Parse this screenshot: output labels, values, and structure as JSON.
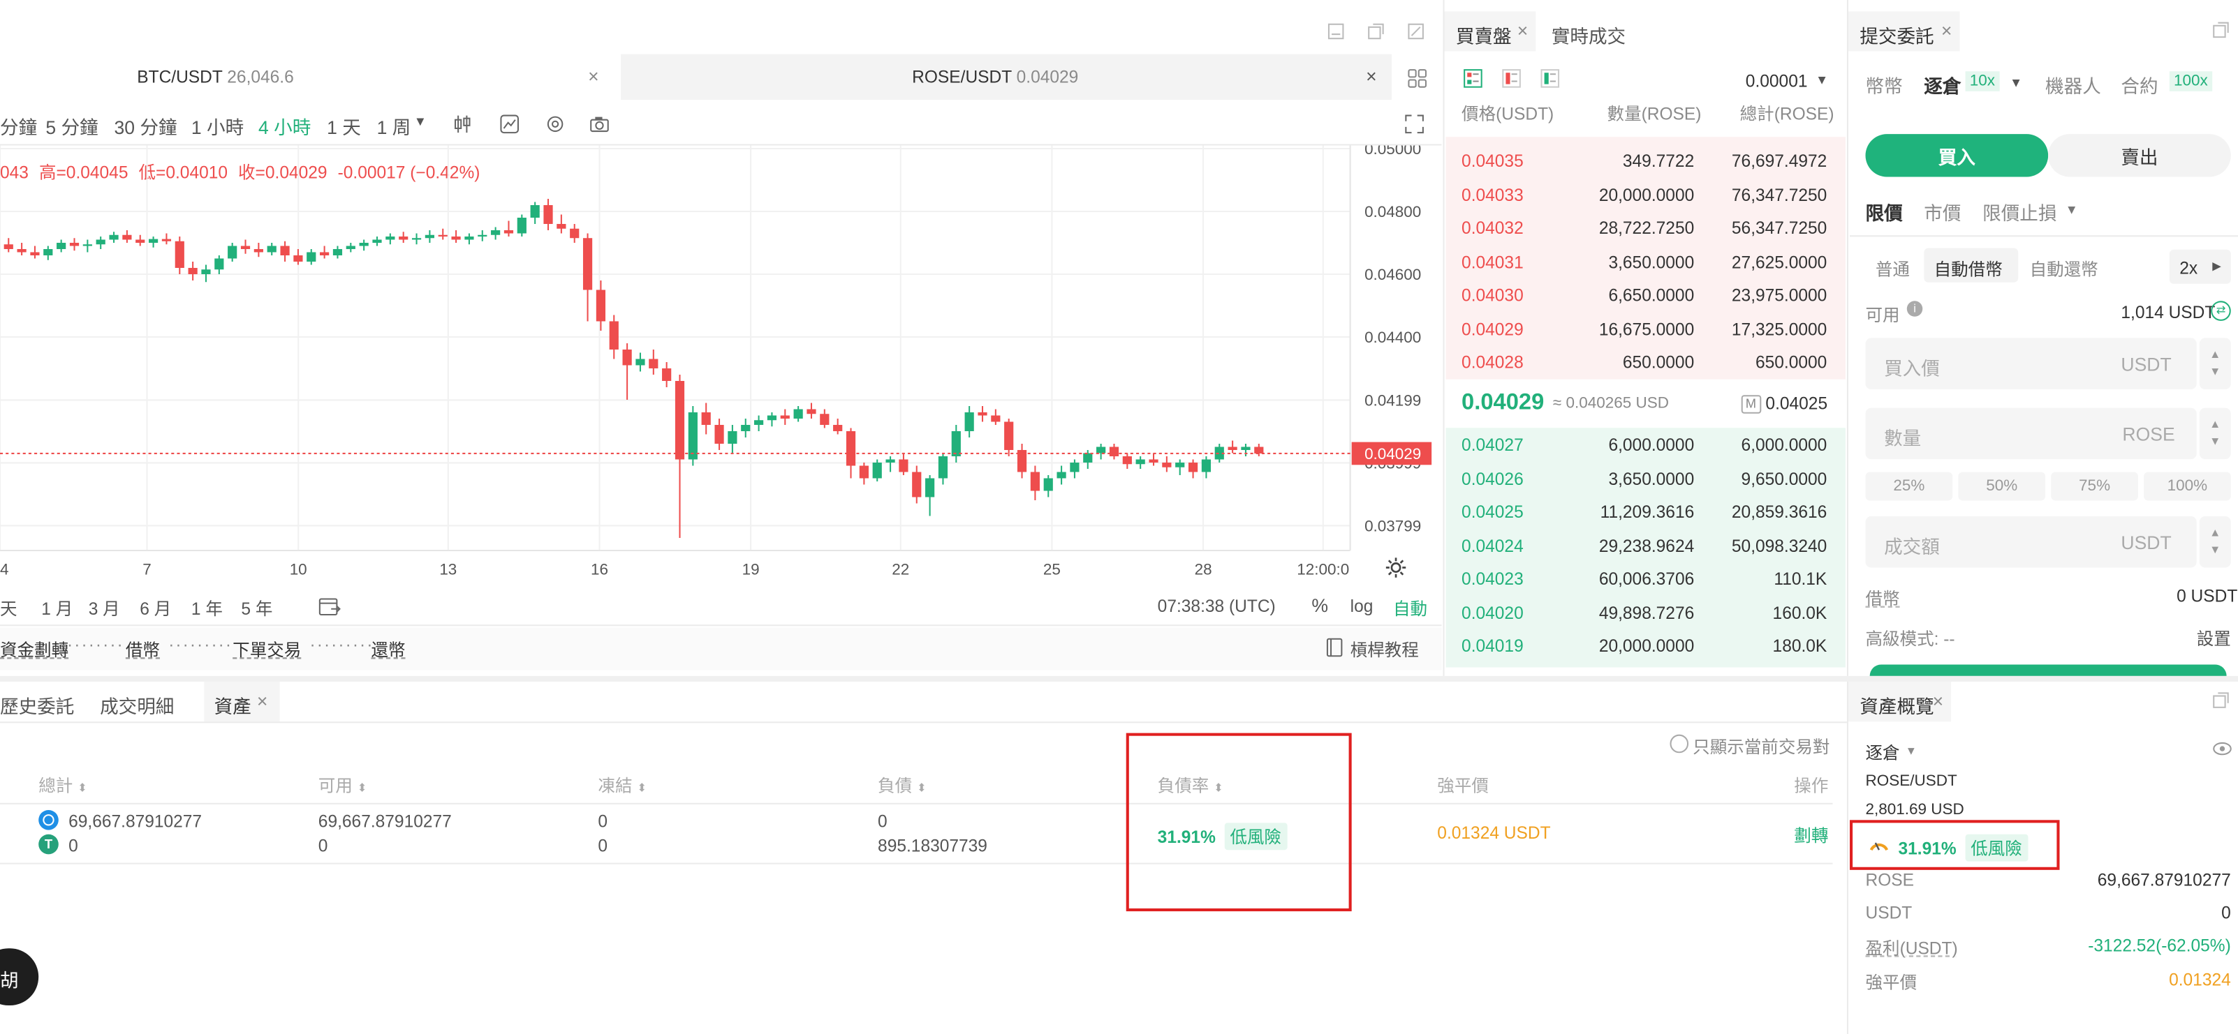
{
  "chart_toolbar": {
    "tabs": [
      {
        "pair": "BTC/USDT",
        "price": "26,046.6"
      },
      {
        "pair": "ROSE/USDT",
        "price": "0.04029"
      }
    ],
    "intervals": [
      "分鐘",
      "5 分鐘",
      "30 分鐘",
      "1 小時",
      "4 小時",
      "1 天",
      "1 周"
    ],
    "active_interval": "4 小時",
    "ohlc": {
      "open_fragment": "043",
      "high": "高=0.04045",
      "low": "低=0.04010",
      "close": "收=0.04029",
      "change": "-0.00017 (−0.42%)"
    },
    "ranges": [
      "天",
      "1 月",
      "3 月",
      "6 月",
      "1 年",
      "5 年"
    ],
    "clock": "07:38:38 (UTC)",
    "scale_pct": "%",
    "scale_log": "log",
    "scale_auto": "自動",
    "flow": [
      "資金劃轉",
      "借幣",
      "下單交易",
      "還幣"
    ],
    "tutorial": "槓桿教程"
  },
  "chart_data": {
    "type": "candlestick",
    "x_ticks": [
      "4",
      "7",
      "10",
      "13",
      "16",
      "19",
      "22",
      "25",
      "28",
      "12:00:0"
    ],
    "y_ticks": [
      "0.05000",
      "0.04800",
      "0.04600",
      "0.04400",
      "0.04199",
      "0.03999",
      "0.03799"
    ],
    "ylim": [
      0.0372,
      0.0501
    ],
    "last_price": "0.04029",
    "last_value": 0.04029,
    "candles": [
      {
        "o": 0.04695,
        "h": 0.04715,
        "l": 0.0467,
        "c": 0.0468
      },
      {
        "o": 0.0468,
        "h": 0.047,
        "l": 0.0466,
        "c": 0.0467
      },
      {
        "o": 0.0467,
        "h": 0.0469,
        "l": 0.0465,
        "c": 0.0466
      },
      {
        "o": 0.0466,
        "h": 0.0469,
        "l": 0.04645,
        "c": 0.0468
      },
      {
        "o": 0.0468,
        "h": 0.0471,
        "l": 0.0467,
        "c": 0.047
      },
      {
        "o": 0.047,
        "h": 0.04715,
        "l": 0.04675,
        "c": 0.0469
      },
      {
        "o": 0.0469,
        "h": 0.0471,
        "l": 0.0467,
        "c": 0.04695
      },
      {
        "o": 0.04695,
        "h": 0.0472,
        "l": 0.0468,
        "c": 0.0471
      },
      {
        "o": 0.0471,
        "h": 0.04735,
        "l": 0.047,
        "c": 0.04725
      },
      {
        "o": 0.04725,
        "h": 0.0474,
        "l": 0.047,
        "c": 0.0471
      },
      {
        "o": 0.0471,
        "h": 0.04725,
        "l": 0.0469,
        "c": 0.047
      },
      {
        "o": 0.047,
        "h": 0.0472,
        "l": 0.04685,
        "c": 0.04712
      },
      {
        "o": 0.04712,
        "h": 0.0473,
        "l": 0.04695,
        "c": 0.04705
      },
      {
        "o": 0.04705,
        "h": 0.0472,
        "l": 0.046,
        "c": 0.0462
      },
      {
        "o": 0.0462,
        "h": 0.0464,
        "l": 0.0458,
        "c": 0.046
      },
      {
        "o": 0.046,
        "h": 0.0463,
        "l": 0.04575,
        "c": 0.04615
      },
      {
        "o": 0.04615,
        "h": 0.0466,
        "l": 0.046,
        "c": 0.0465
      },
      {
        "o": 0.0465,
        "h": 0.047,
        "l": 0.0464,
        "c": 0.0469
      },
      {
        "o": 0.0469,
        "h": 0.0471,
        "l": 0.04665,
        "c": 0.0468
      },
      {
        "o": 0.0468,
        "h": 0.047,
        "l": 0.04655,
        "c": 0.0467
      },
      {
        "o": 0.0467,
        "h": 0.047,
        "l": 0.0466,
        "c": 0.0469
      },
      {
        "o": 0.0469,
        "h": 0.04705,
        "l": 0.0464,
        "c": 0.0466
      },
      {
        "o": 0.0466,
        "h": 0.0468,
        "l": 0.0463,
        "c": 0.0464
      },
      {
        "o": 0.0464,
        "h": 0.0468,
        "l": 0.0463,
        "c": 0.0467
      },
      {
        "o": 0.0467,
        "h": 0.0469,
        "l": 0.0465,
        "c": 0.0466
      },
      {
        "o": 0.0466,
        "h": 0.0469,
        "l": 0.0465,
        "c": 0.0468
      },
      {
        "o": 0.0468,
        "h": 0.047,
        "l": 0.0467,
        "c": 0.0469
      },
      {
        "o": 0.0469,
        "h": 0.0471,
        "l": 0.04675,
        "c": 0.047
      },
      {
        "o": 0.047,
        "h": 0.0472,
        "l": 0.0469,
        "c": 0.0471
      },
      {
        "o": 0.0471,
        "h": 0.0473,
        "l": 0.04695,
        "c": 0.0472
      },
      {
        "o": 0.0472,
        "h": 0.04735,
        "l": 0.047,
        "c": 0.0471
      },
      {
        "o": 0.0471,
        "h": 0.0473,
        "l": 0.04695,
        "c": 0.04715
      },
      {
        "o": 0.04715,
        "h": 0.0474,
        "l": 0.047,
        "c": 0.04725
      },
      {
        "o": 0.04725,
        "h": 0.04745,
        "l": 0.0471,
        "c": 0.0472
      },
      {
        "o": 0.0472,
        "h": 0.0474,
        "l": 0.047,
        "c": 0.0471
      },
      {
        "o": 0.0471,
        "h": 0.0473,
        "l": 0.04695,
        "c": 0.0472
      },
      {
        "o": 0.0472,
        "h": 0.0474,
        "l": 0.04705,
        "c": 0.04725
      },
      {
        "o": 0.04725,
        "h": 0.0475,
        "l": 0.0471,
        "c": 0.0474
      },
      {
        "o": 0.0474,
        "h": 0.0477,
        "l": 0.0472,
        "c": 0.0473
      },
      {
        "o": 0.0473,
        "h": 0.0479,
        "l": 0.0472,
        "c": 0.0478
      },
      {
        "o": 0.0478,
        "h": 0.0483,
        "l": 0.0476,
        "c": 0.0482
      },
      {
        "o": 0.0482,
        "h": 0.0484,
        "l": 0.0474,
        "c": 0.0476
      },
      {
        "o": 0.0476,
        "h": 0.0479,
        "l": 0.0473,
        "c": 0.04745
      },
      {
        "o": 0.04745,
        "h": 0.0476,
        "l": 0.047,
        "c": 0.04715
      },
      {
        "o": 0.04715,
        "h": 0.0473,
        "l": 0.0445,
        "c": 0.0455
      },
      {
        "o": 0.0455,
        "h": 0.0458,
        "l": 0.0442,
        "c": 0.0445
      },
      {
        "o": 0.0445,
        "h": 0.0447,
        "l": 0.0433,
        "c": 0.0436
      },
      {
        "o": 0.0436,
        "h": 0.0438,
        "l": 0.042,
        "c": 0.0431
      },
      {
        "o": 0.0431,
        "h": 0.0435,
        "l": 0.0429,
        "c": 0.0433
      },
      {
        "o": 0.0433,
        "h": 0.0436,
        "l": 0.0428,
        "c": 0.043
      },
      {
        "o": 0.043,
        "h": 0.0432,
        "l": 0.0424,
        "c": 0.0426
      },
      {
        "o": 0.0426,
        "h": 0.0428,
        "l": 0.0376,
        "c": 0.0401
      },
      {
        "o": 0.0401,
        "h": 0.0418,
        "l": 0.0399,
        "c": 0.0416
      },
      {
        "o": 0.0416,
        "h": 0.0419,
        "l": 0.0409,
        "c": 0.0412
      },
      {
        "o": 0.0412,
        "h": 0.0414,
        "l": 0.0404,
        "c": 0.0406
      },
      {
        "o": 0.0406,
        "h": 0.0412,
        "l": 0.0403,
        "c": 0.041
      },
      {
        "o": 0.041,
        "h": 0.0414,
        "l": 0.0408,
        "c": 0.0412
      },
      {
        "o": 0.0412,
        "h": 0.0415,
        "l": 0.041,
        "c": 0.04135
      },
      {
        "o": 0.04135,
        "h": 0.0416,
        "l": 0.04115,
        "c": 0.0415
      },
      {
        "o": 0.0415,
        "h": 0.0417,
        "l": 0.0412,
        "c": 0.0414
      },
      {
        "o": 0.0414,
        "h": 0.0418,
        "l": 0.0413,
        "c": 0.0417
      },
      {
        "o": 0.0417,
        "h": 0.0419,
        "l": 0.0414,
        "c": 0.04155
      },
      {
        "o": 0.04155,
        "h": 0.0417,
        "l": 0.0411,
        "c": 0.0412
      },
      {
        "o": 0.0412,
        "h": 0.0414,
        "l": 0.0409,
        "c": 0.041
      },
      {
        "o": 0.041,
        "h": 0.0411,
        "l": 0.0395,
        "c": 0.0399
      },
      {
        "o": 0.0399,
        "h": 0.04,
        "l": 0.0393,
        "c": 0.0395
      },
      {
        "o": 0.0395,
        "h": 0.0401,
        "l": 0.0394,
        "c": 0.04
      },
      {
        "o": 0.04,
        "h": 0.0402,
        "l": 0.0397,
        "c": 0.0401
      },
      {
        "o": 0.0401,
        "h": 0.0403,
        "l": 0.0396,
        "c": 0.0397
      },
      {
        "o": 0.0397,
        "h": 0.0399,
        "l": 0.0387,
        "c": 0.0389
      },
      {
        "o": 0.0389,
        "h": 0.0396,
        "l": 0.0383,
        "c": 0.0395
      },
      {
        "o": 0.0395,
        "h": 0.0403,
        "l": 0.0393,
        "c": 0.0402
      },
      {
        "o": 0.0402,
        "h": 0.0412,
        "l": 0.04,
        "c": 0.041
      },
      {
        "o": 0.041,
        "h": 0.0418,
        "l": 0.0408,
        "c": 0.0416
      },
      {
        "o": 0.0416,
        "h": 0.0418,
        "l": 0.0413,
        "c": 0.0415
      },
      {
        "o": 0.0415,
        "h": 0.0417,
        "l": 0.0412,
        "c": 0.0413
      },
      {
        "o": 0.0413,
        "h": 0.0414,
        "l": 0.0402,
        "c": 0.0404
      },
      {
        "o": 0.0404,
        "h": 0.0406,
        "l": 0.0395,
        "c": 0.0397
      },
      {
        "o": 0.0397,
        "h": 0.0399,
        "l": 0.0388,
        "c": 0.0391
      },
      {
        "o": 0.0391,
        "h": 0.0396,
        "l": 0.0389,
        "c": 0.0395
      },
      {
        "o": 0.0395,
        "h": 0.0399,
        "l": 0.0393,
        "c": 0.0397
      },
      {
        "o": 0.0397,
        "h": 0.0401,
        "l": 0.0395,
        "c": 0.04
      },
      {
        "o": 0.04,
        "h": 0.0404,
        "l": 0.0398,
        "c": 0.0403
      },
      {
        "o": 0.0403,
        "h": 0.0406,
        "l": 0.0401,
        "c": 0.0405
      },
      {
        "o": 0.0405,
        "h": 0.0406,
        "l": 0.0401,
        "c": 0.0402
      },
      {
        "o": 0.0402,
        "h": 0.0403,
        "l": 0.0398,
        "c": 0.03995
      },
      {
        "o": 0.03995,
        "h": 0.0402,
        "l": 0.0398,
        "c": 0.0401
      },
      {
        "o": 0.0401,
        "h": 0.0403,
        "l": 0.0399,
        "c": 0.04
      },
      {
        "o": 0.04,
        "h": 0.0402,
        "l": 0.0397,
        "c": 0.03985
      },
      {
        "o": 0.03985,
        "h": 0.0401,
        "l": 0.0396,
        "c": 0.04
      },
      {
        "o": 0.04,
        "h": 0.0401,
        "l": 0.0395,
        "c": 0.0397
      },
      {
        "o": 0.0397,
        "h": 0.0402,
        "l": 0.0395,
        "c": 0.0401
      },
      {
        "o": 0.0401,
        "h": 0.0406,
        "l": 0.04,
        "c": 0.0405
      },
      {
        "o": 0.0405,
        "h": 0.0407,
        "l": 0.0403,
        "c": 0.0404
      },
      {
        "o": 0.0404,
        "h": 0.0406,
        "l": 0.0402,
        "c": 0.0405
      },
      {
        "o": 0.0405,
        "h": 0.0406,
        "l": 0.0402,
        "c": 0.04029
      }
    ]
  },
  "orderbook": {
    "tabs": [
      "買賣盤",
      "實時成交"
    ],
    "precision": "0.00001",
    "headers": [
      "價格(USDT)",
      "數量(ROSE)",
      "總計(ROSE)"
    ],
    "asks": [
      [
        "0.04035",
        "349.7722",
        "76,697.4972"
      ],
      [
        "0.04033",
        "20,000.0000",
        "76,347.7250"
      ],
      [
        "0.04032",
        "28,722.7250",
        "56,347.7250"
      ],
      [
        "0.04031",
        "3,650.0000",
        "27,625.0000"
      ],
      [
        "0.04030",
        "6,650.0000",
        "23,975.0000"
      ],
      [
        "0.04029",
        "16,675.0000",
        "17,325.0000"
      ],
      [
        "0.04028",
        "650.0000",
        "650.0000"
      ]
    ],
    "mid": {
      "price": "0.04029",
      "approx": "≈ 0.040265 USD",
      "mark_icon": "M",
      "mark": "0.04025"
    },
    "bids": [
      [
        "0.04027",
        "6,000.0000",
        "6,000.0000"
      ],
      [
        "0.04026",
        "3,650.0000",
        "9,650.0000"
      ],
      [
        "0.04025",
        "11,209.3616",
        "20,859.3616"
      ],
      [
        "0.04024",
        "29,238.9624",
        "50,098.3240"
      ],
      [
        "0.04023",
        "60,006.3706",
        "110.1K"
      ],
      [
        "0.04020",
        "49,898.7276",
        "160.0K"
      ],
      [
        "0.04019",
        "20,000.0000",
        "180.0K"
      ]
    ]
  },
  "order_form": {
    "title": "提交委託",
    "modes": [
      "幣幣",
      "逐倉",
      "機器人",
      "合約"
    ],
    "isolated_leverage": "10x",
    "contract_leverage": "100x",
    "buy": "買入",
    "sell": "賣出",
    "types": [
      "限價",
      "市價",
      "限價止損"
    ],
    "borrow_modes": [
      "普通",
      "自動借幣",
      "自動還幣"
    ],
    "leverage_btn": "2x",
    "available_label": "可用",
    "available_value": "1,014 USDT",
    "price_placeholder": "買入價",
    "price_unit": "USDT",
    "qty_placeholder": "數量",
    "qty_unit": "ROSE",
    "pcts": [
      "25%",
      "50%",
      "75%",
      "100%"
    ],
    "amount_placeholder": "成交額",
    "amount_unit": "USDT",
    "borrow_label": "借幣",
    "borrow_value": "0 USDT",
    "advanced_label": "高級模式: --",
    "settings": "設置"
  },
  "bottom": {
    "tabs": [
      "歷史委託",
      "成交明細",
      "資產"
    ],
    "only_current": "只顯示當前交易對",
    "headers": [
      "總計",
      "可用",
      "凍結",
      "負債",
      "負債率",
      "強平價",
      "操作"
    ],
    "row": {
      "total_rose": "69,667.87910277",
      "total_usdt": "0",
      "avail_rose": "69,667.87910277",
      "avail_usdt": "0",
      "frozen_rose": "0",
      "frozen_usdt": "0",
      "debt_rose": "0",
      "debt_usdt": "895.18307739",
      "ratio": "31.91%",
      "risk": "低風險",
      "liq": "0.01324 USDT",
      "action": "劃轉"
    },
    "chat_btn": "胡"
  },
  "overview": {
    "title": "資產概覽",
    "mode": "逐倉",
    "pair": "ROSE/USDT",
    "value": "2,801.69 USD",
    "ratio": "31.91%",
    "risk": "低風險",
    "rows": [
      {
        "label": "ROSE",
        "value": "69,667.87910277"
      },
      {
        "label": "USDT",
        "value": "0"
      },
      {
        "label": "盈利(USDT)",
        "value": "-3122.52(-62.05%)"
      },
      {
        "label": "強平價",
        "value": "0.01324"
      }
    ]
  },
  "colors": {
    "up": "#21b07a",
    "down": "#ee4d4d",
    "accent": "#1fb37c",
    "warning": "#f0a020",
    "highlight": "#e02020"
  }
}
